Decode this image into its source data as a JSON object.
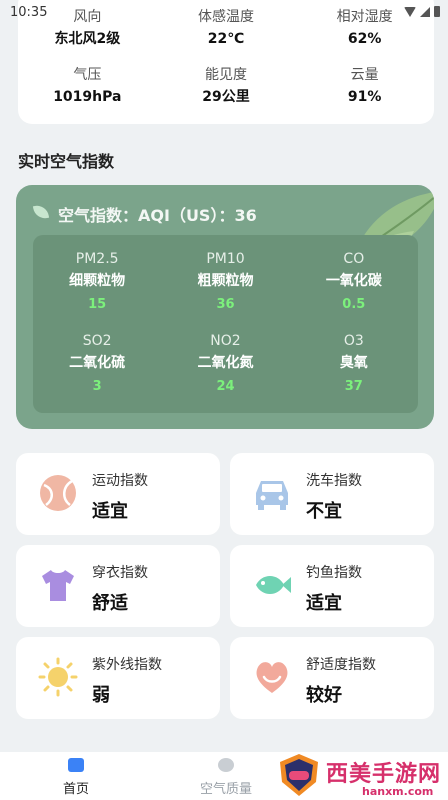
{
  "status_bar": {
    "time": "10:35"
  },
  "weather": {
    "items": [
      {
        "label": "风向",
        "value": "东北风2级"
      },
      {
        "label": "体感温度",
        "value": "22℃"
      },
      {
        "label": "相对湿度",
        "value": "62%"
      },
      {
        "label": "气压",
        "value": "1019hPa"
      },
      {
        "label": "能见度",
        "value": "29公里"
      },
      {
        "label": "云量",
        "value": "91%"
      }
    ]
  },
  "section": {
    "title": "实时空气指数"
  },
  "aqi": {
    "title": "空气指数：AQI（US）：36",
    "pollutants": [
      {
        "code": "PM2.5",
        "name": "细颗粒物",
        "value": "15"
      },
      {
        "code": "PM10",
        "name": "粗颗粒物",
        "value": "36"
      },
      {
        "code": "CO",
        "name": "一氧化碳",
        "value": "0.5"
      },
      {
        "code": "SO2",
        "name": "二氧化硫",
        "value": "3"
      },
      {
        "code": "NO2",
        "name": "二氧化氮",
        "value": "24"
      },
      {
        "code": "O3",
        "name": "臭氧",
        "value": "37"
      }
    ]
  },
  "indices": [
    {
      "label": "运动指数",
      "value": "适宜",
      "icon": "ball-icon"
    },
    {
      "label": "洗车指数",
      "value": "不宜",
      "icon": "car-icon"
    },
    {
      "label": "穿衣指数",
      "value": "舒适",
      "icon": "shirt-icon"
    },
    {
      "label": "钓鱼指数",
      "value": "适宜",
      "icon": "fish-icon"
    },
    {
      "label": "紫外线指数",
      "value": "弱",
      "icon": "sun-icon"
    },
    {
      "label": "舒适度指数",
      "value": "较好",
      "icon": "heart-icon"
    }
  ],
  "tabs": [
    {
      "label": "首页",
      "active": true
    },
    {
      "label": "空气质量",
      "active": false
    }
  ],
  "watermark": {
    "text": "西美手游网",
    "url": "hanxm.com"
  },
  "colors": {
    "card_green": "#7ba48b",
    "inner_green": "#6b9379",
    "value_green": "#7cf07c",
    "tab_active": "#3b82f6"
  }
}
